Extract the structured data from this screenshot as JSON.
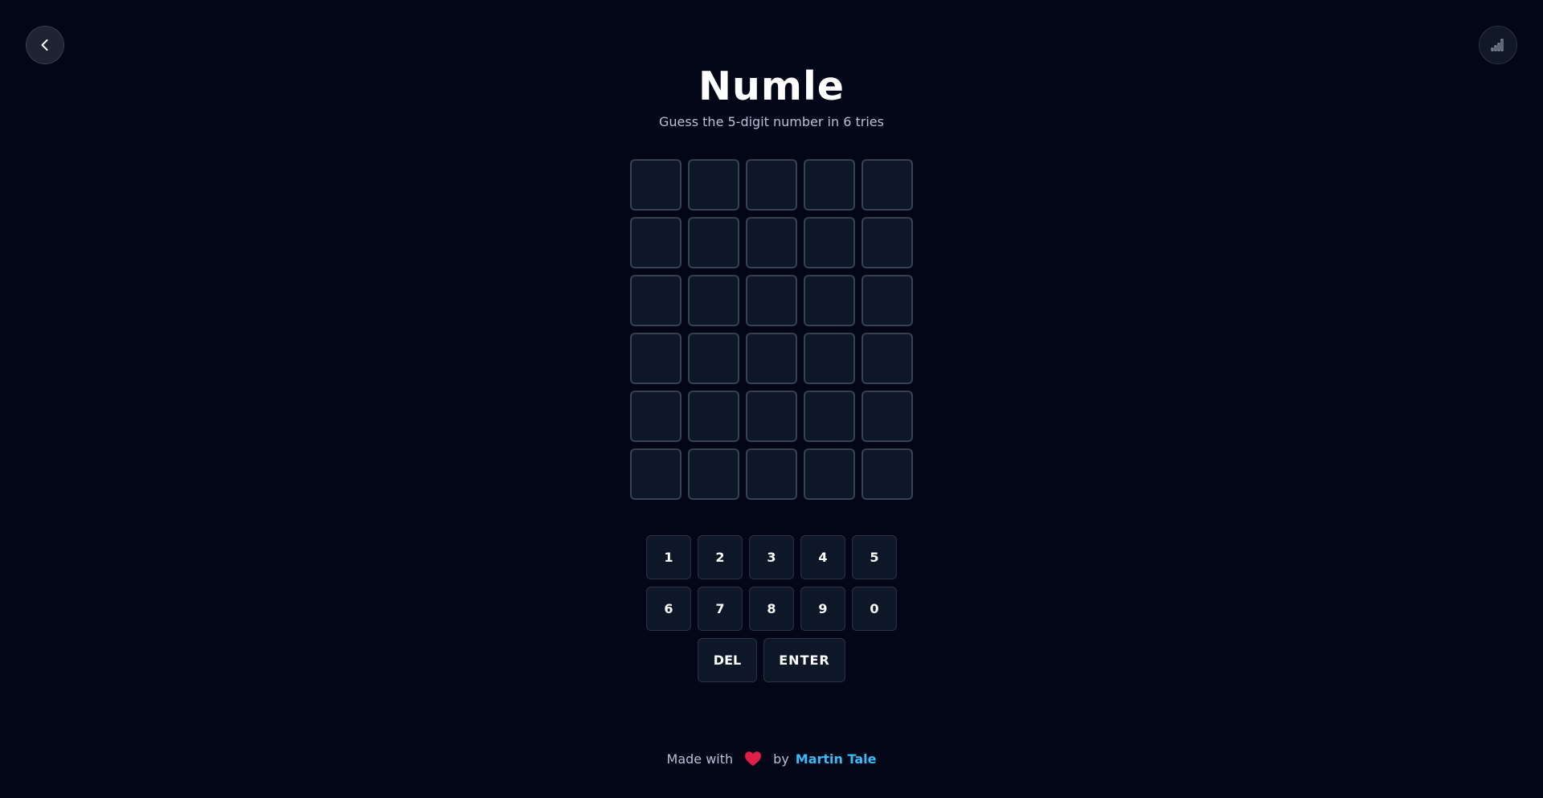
{
  "header": {
    "title": "Numle",
    "subtitle": "Guess the 5-digit number in 6 tries",
    "back_icon": "chevron-left-icon",
    "stats_icon": "signal-bars-icon"
  },
  "board": {
    "rows": [
      [
        "",
        "",
        "",
        "",
        ""
      ],
      [
        "",
        "",
        "",
        "",
        ""
      ],
      [
        "",
        "",
        "",
        "",
        ""
      ],
      [
        "",
        "",
        "",
        "",
        ""
      ],
      [
        "",
        "",
        "",
        "",
        ""
      ],
      [
        "",
        "",
        "",
        "",
        ""
      ]
    ]
  },
  "keyboard": {
    "row1": [
      "1",
      "2",
      "3",
      "4",
      "5"
    ],
    "row2": [
      "6",
      "7",
      "8",
      "9",
      "0"
    ],
    "delete_label": "DEL",
    "enter_label": "ENTER"
  },
  "footer": {
    "made_with": "Made with",
    "by": "by",
    "author": "Martin Tale",
    "heart_icon": "heart-icon"
  },
  "colors": {
    "background": "#030617",
    "tile_bg": "#0e1728",
    "tile_border": "#374152",
    "accent_link": "#38bdf8",
    "heart": "#e11d48"
  }
}
